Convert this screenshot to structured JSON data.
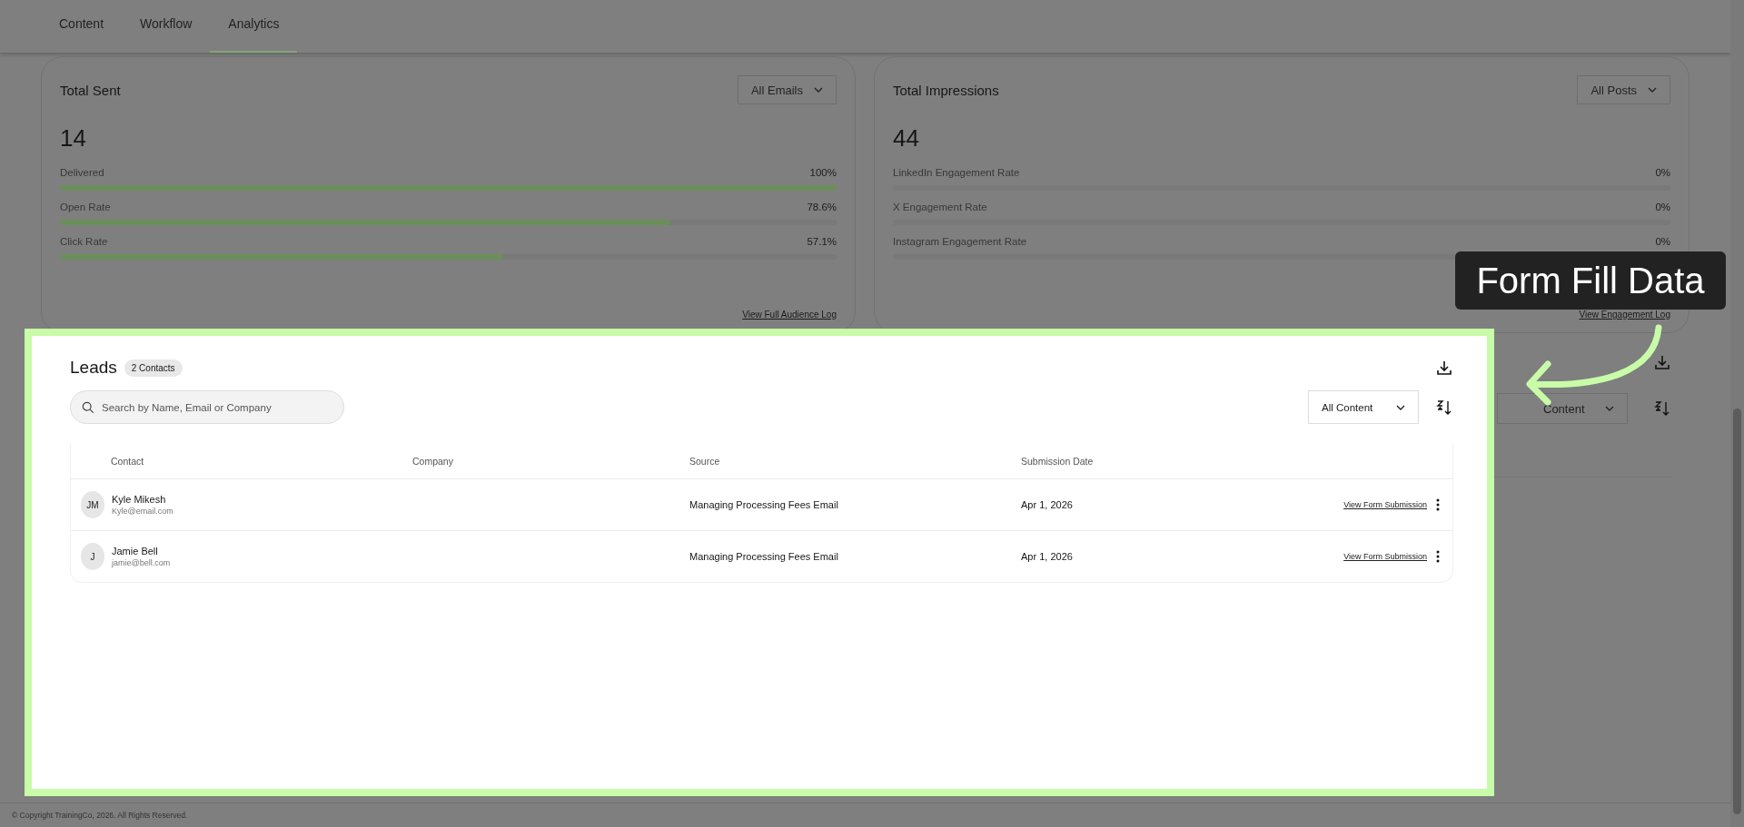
{
  "tabs": [
    {
      "label": "Content",
      "selected": false
    },
    {
      "label": "Workflow",
      "selected": false
    },
    {
      "label": "Analytics",
      "selected": true
    }
  ],
  "cards": [
    {
      "title": "Total Sent",
      "filter": "All Emails",
      "total": "14",
      "link": "View Full Audience Log",
      "metrics": [
        {
          "label": "Delivered",
          "value": "100%",
          "level": 1
        },
        {
          "label": "Open Rate",
          "value": "78.6%",
          "level": 0.786
        },
        {
          "label": "Click Rate",
          "value": "57.1%",
          "level": 0.571
        }
      ]
    },
    {
      "title": "Total Impressions",
      "filter": "All Posts",
      "total": "44",
      "link": "View Engagement Log",
      "metrics": [
        {
          "label": "LinkedIn Engagement Rate",
          "value": "0%",
          "level": 0
        },
        {
          "label": "X Engagement Rate",
          "value": "0%",
          "level": 0
        },
        {
          "label": "Instagram Engagement Rate",
          "value": "0%",
          "level": 0
        }
      ]
    }
  ],
  "background_leads": {
    "filter": "Content"
  },
  "leads": {
    "title": "Leads",
    "count": "2 Contacts",
    "search": {
      "placeholder": "Search by Name, Email or Company"
    },
    "filter": "All Content",
    "columns": [
      "Contact",
      "Company",
      "Source",
      "Submission Date"
    ],
    "rows": [
      {
        "initials": "JM",
        "name": "Kyle Mikesh",
        "email": "Kyle@email.com",
        "source": "Managing Processing Fees Email",
        "date": "Apr 1, 2026",
        "action": "View Form Submission"
      },
      {
        "initials": "J",
        "name": "Jamie Bell",
        "email": "jamie@bell.com",
        "source": "Managing Processing Fees Email",
        "date": "Apr 1, 2026",
        "action": "View Form Submission"
      }
    ]
  },
  "callout": {
    "text": "Form Fill Data"
  },
  "footer": "© Copyright TrainingCo, 2026. All Rights Reserved."
}
